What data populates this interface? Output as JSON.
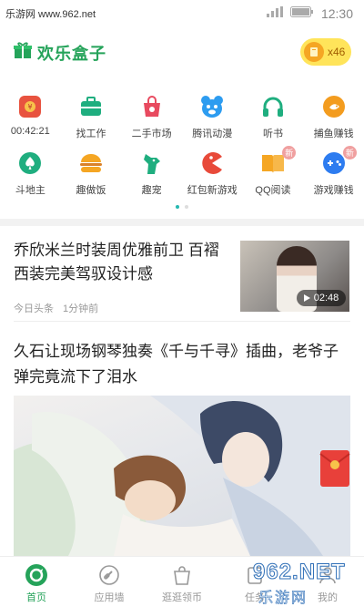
{
  "status": {
    "watermark": "乐游网 www.962.net",
    "time": "12:30"
  },
  "header": {
    "app_name": "欢乐盒子",
    "coins": "x46"
  },
  "grid_row1": [
    {
      "label": "00:42:21",
      "icon": "red-envelope-timer-icon",
      "color": "#e8533f"
    },
    {
      "label": "找工作",
      "icon": "briefcase-icon",
      "color": "#1fae7f"
    },
    {
      "label": "二手市场",
      "icon": "shopping-bag-icon",
      "color": "#e84a5f"
    },
    {
      "label": "腾讯动漫",
      "icon": "bear-icon",
      "color": "#2d9cf0"
    },
    {
      "label": "听书",
      "icon": "headphones-icon",
      "color": "#1fae7f"
    },
    {
      "label": "捕鱼赚钱",
      "icon": "fishing-icon",
      "color": "#f39c1f"
    }
  ],
  "grid_row2": [
    {
      "label": "斗地主",
      "icon": "spade-icon",
      "color": "#1fae7f"
    },
    {
      "label": "趣做饭",
      "icon": "burger-icon",
      "color": "#f5a623"
    },
    {
      "label": "趣宠",
      "icon": "dog-icon",
      "color": "#1fae7f"
    },
    {
      "label": "红包新游戏",
      "icon": "pacman-icon",
      "color": "#e84a3a"
    },
    {
      "label": "QQ阅读",
      "icon": "book-icon",
      "color": "#f5a623",
      "badge": "新"
    },
    {
      "label": "游戏赚钱",
      "icon": "gamepad-icon",
      "color": "#2d7cf0",
      "badge": "新"
    }
  ],
  "news": [
    {
      "title": "乔欣米兰时装周优雅前卫 百褶西装完美驾驭设计感",
      "source": "今日头条",
      "time": "1分钟前",
      "duration": "02:48"
    },
    {
      "title": "久石让现场钢琴独奏《千与千寻》插曲，老爷子弹完竟流下了泪水"
    }
  ],
  "tabbar": [
    {
      "label": "首页",
      "icon": "home-icon",
      "active": true
    },
    {
      "label": "应用墙",
      "icon": "link-icon"
    },
    {
      "label": "逛逛领币",
      "icon": "shopping-bag-icon"
    },
    {
      "label": "任务",
      "icon": "task-icon"
    },
    {
      "label": "我的",
      "icon": "user-icon"
    }
  ],
  "overlay_watermark": {
    "number": "962.NET",
    "text": "乐游网"
  },
  "colors": {
    "brand": "#25a35a",
    "coin_bg": "#ffe45a",
    "accent_dot": "#25b8b0"
  }
}
